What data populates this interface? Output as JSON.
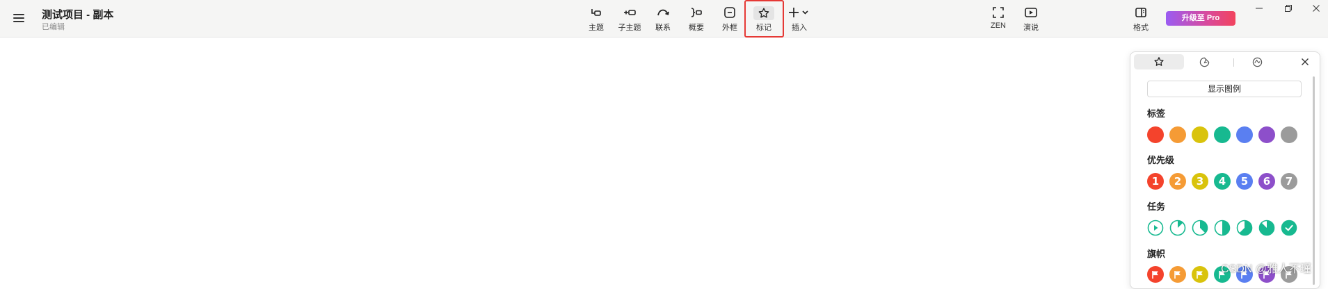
{
  "header": {
    "doc_title": "测试项目 - 副本",
    "doc_status": "已编辑",
    "pro_button": "升级至 Pro",
    "tools": [
      {
        "label": "主题",
        "icon": "topic-icon"
      },
      {
        "label": "子主题",
        "icon": "subtopic-icon"
      },
      {
        "label": "联系",
        "icon": "relationship-icon"
      },
      {
        "label": "概要",
        "icon": "summary-icon"
      },
      {
        "label": "外框",
        "icon": "boundary-icon"
      },
      {
        "label": "标记",
        "icon": "star-icon"
      },
      {
        "label": "插入",
        "icon": "plus-icon"
      }
    ],
    "right_tools": [
      {
        "label": "ZEN",
        "icon": "fullscreen-icon"
      },
      {
        "label": "演说",
        "icon": "play-icon"
      },
      {
        "label": "格式",
        "icon": "format-panel-icon"
      }
    ]
  },
  "panel": {
    "legend_button": "显示图例",
    "sections": {
      "tags": "标签",
      "priority": "优先级",
      "task": "任务",
      "flags": "旗帜"
    },
    "priority_numbers": [
      "1",
      "2",
      "3",
      "4",
      "5",
      "6",
      "7"
    ],
    "colors": [
      "#f4432c",
      "#f59b35",
      "#d9c30c",
      "#17b990",
      "#5a7ff1",
      "#8d4fca",
      "#9b9b9b"
    ],
    "task_color": "#17b990",
    "task_progress": [
      0,
      0.125,
      0.375,
      0.5,
      0.625,
      0.875,
      1
    ]
  },
  "watermark": "CSDN @雅人不瑾"
}
